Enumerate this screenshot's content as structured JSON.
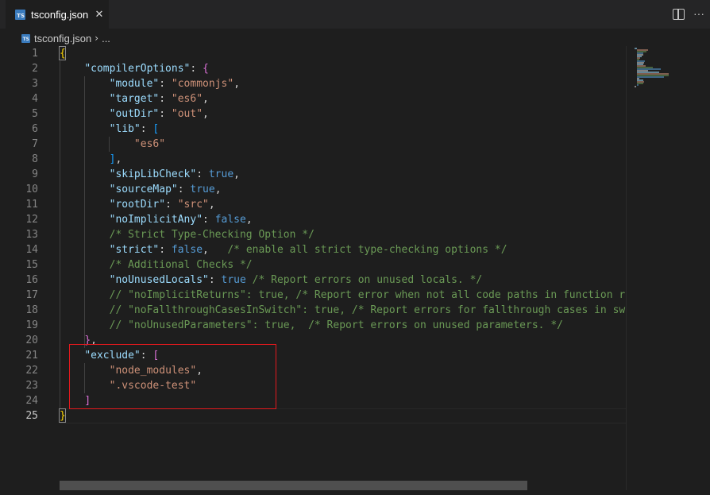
{
  "tab": {
    "icon": "ts-file-icon",
    "icon_text": "TS",
    "label": "tsconfig.json",
    "close": "✕"
  },
  "actions": {
    "split_editor": "split-editor-icon",
    "more": "···"
  },
  "breadcrumb": {
    "file": "tsconfig.json",
    "separator": "›",
    "more": "..."
  },
  "editor": {
    "active_line": 25,
    "lines": [
      {
        "n": "1"
      },
      {
        "n": "2"
      },
      {
        "n": "3"
      },
      {
        "n": "4"
      },
      {
        "n": "5"
      },
      {
        "n": "6"
      },
      {
        "n": "7"
      },
      {
        "n": "8"
      },
      {
        "n": "9"
      },
      {
        "n": "10"
      },
      {
        "n": "11"
      },
      {
        "n": "12"
      },
      {
        "n": "13"
      },
      {
        "n": "14"
      },
      {
        "n": "15"
      },
      {
        "n": "16"
      },
      {
        "n": "17"
      },
      {
        "n": "18"
      },
      {
        "n": "19"
      },
      {
        "n": "20"
      },
      {
        "n": "21"
      },
      {
        "n": "22"
      },
      {
        "n": "23"
      },
      {
        "n": "24"
      },
      {
        "n": "25"
      }
    ],
    "code": {
      "l1_open": "{",
      "l2_key": "\"compilerOptions\"",
      "l2_colon": ": ",
      "l2_open": "{",
      "l3_key": "\"module\"",
      "l3_val": "\"commonjs\"",
      "l4_key": "\"target\"",
      "l4_val": "\"es6\"",
      "l5_key": "\"outDir\"",
      "l5_val": "\"out\"",
      "l6_key": "\"lib\"",
      "l6_open": "[",
      "l7_val": "\"es6\"",
      "l8_close": "]",
      "l9_key": "\"skipLibCheck\"",
      "l9_val": "true",
      "l10_key": "\"sourceMap\"",
      "l10_val": "true",
      "l11_key": "\"rootDir\"",
      "l11_val": "\"src\"",
      "l12_key": "\"noImplicitAny\"",
      "l12_val": "false",
      "l13_comment": "/* Strict Type-Checking Option */",
      "l14_key": "\"strict\"",
      "l14_val": "false",
      "l14_comment": "/* enable all strict type-checking options */",
      "l15_comment": "/* Additional Checks */",
      "l16_key": "\"noUnusedLocals\"",
      "l16_val": "true",
      "l16_comment": "/* Report errors on unused locals. */",
      "l17_comment": "// \"noImplicitReturns\": true, /* Report error when not all code paths in function ret",
      "l18_comment": "// \"noFallthroughCasesInSwitch\": true, /* Report errors for fallthrough cases in swit",
      "l19_comment": "// \"noUnusedParameters\": true,  /* Report errors on unused parameters. */",
      "l20_close": "}",
      "l21_key": "\"exclude\"",
      "l21_open": "[",
      "l22_val": "\"node_modules\"",
      "l23_val": "\".vscode-test\"",
      "l24_close": "]",
      "l25_close": "}"
    }
  },
  "colors": {
    "background": "#1e1e1e",
    "key": "#9cdcfe",
    "string": "#ce9178",
    "boolean": "#569cd6",
    "comment": "#6a9955",
    "bracket_level1": "#ffd700",
    "bracket_level2": "#da70d6",
    "bracket_level3": "#179fff",
    "highlight_box": "#e5191d"
  }
}
